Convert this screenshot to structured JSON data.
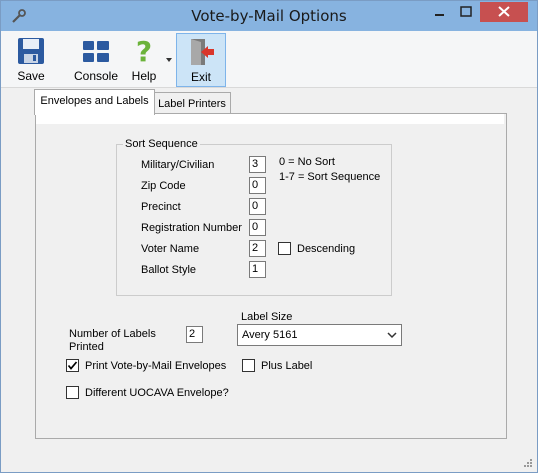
{
  "window": {
    "title": "Vote-by-Mail Options"
  },
  "toolbar": {
    "save_label": "Save",
    "console_label": "Console",
    "help_label": "Help",
    "exit_label": "Exit"
  },
  "tabs": [
    {
      "label": "Envelopes and Labels",
      "selected": true
    },
    {
      "label": "Label Printers",
      "selected": false
    }
  ],
  "sort_sequence": {
    "title": "Sort Sequence",
    "rows": [
      {
        "label": "Military/Civilian",
        "value": "3"
      },
      {
        "label": "Zip Code",
        "value": "0"
      },
      {
        "label": "Precinct",
        "value": "0"
      },
      {
        "label": "Registration Number",
        "value": "0"
      },
      {
        "label": "Voter Name",
        "value": "2"
      },
      {
        "label": "Ballot Style",
        "value": "1"
      }
    ],
    "help_line1": "0 = No Sort",
    "help_line2": "1-7 = Sort Sequence",
    "descending_label": "Descending",
    "descending_checked": false
  },
  "labels": {
    "number_label_line1": "Number of Labels",
    "number_label_line2": "Printed",
    "number_value": "2",
    "size_label": "Label Size",
    "size_value": "Avery 5161"
  },
  "options": {
    "print_envelopes_label": "Print Vote-by-Mail Envelopes",
    "print_envelopes_checked": true,
    "plus_label_label": "Plus Label",
    "plus_label_checked": false,
    "uocava_label": "Different UOCAVA Envelope?",
    "uocava_checked": false
  }
}
